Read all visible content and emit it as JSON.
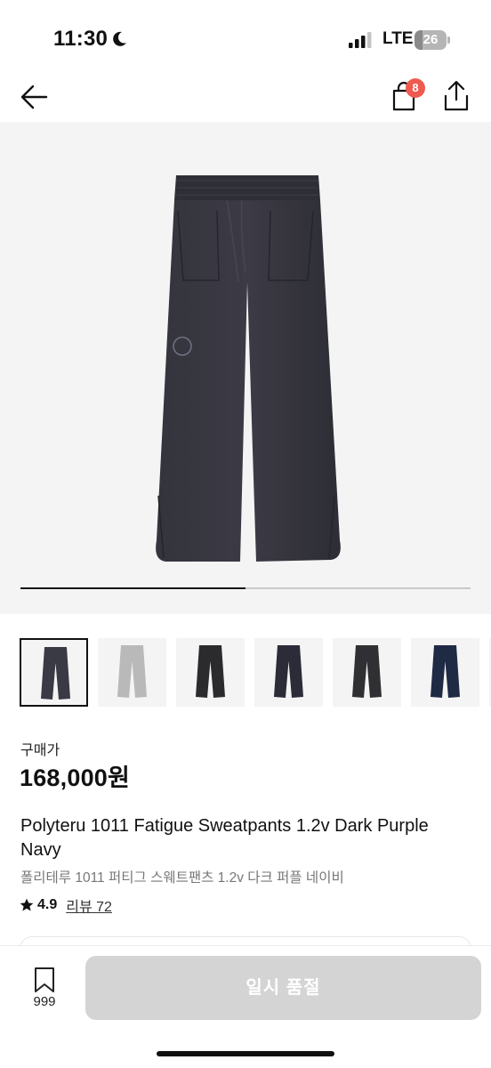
{
  "status_bar": {
    "time": "11:30",
    "network": "LTE",
    "battery": "26",
    "battery_level": 0.26
  },
  "nav": {
    "cart_count": "8",
    "back_icon": "arrow-left-icon",
    "cart_icon": "shopping-bag-icon",
    "share_icon": "share-icon"
  },
  "gallery": {
    "progress": 0.5,
    "thumbnail_colors": [
      "#3a3a44",
      "#b9b9b9",
      "#2b2b2e",
      "#2c2c38",
      "#303034",
      "#1f2a45"
    ]
  },
  "product": {
    "price_label": "구매가",
    "price": "168,000원",
    "title": "Polyteru 1011 Fatigue Sweatpants 1.2v Dark Purple Navy",
    "subtitle": "폴리테루 1011 퍼티그 스웨트팬츠 1.2v 다크 퍼플 네이비",
    "rating": "4.9",
    "review_link": "리뷰 72"
  },
  "bottom": {
    "wish_count": "999",
    "soldout_label": "일시 품절"
  },
  "colors": {
    "badge": "#ef5a4f",
    "disabled_button": "#d4d4d4"
  }
}
